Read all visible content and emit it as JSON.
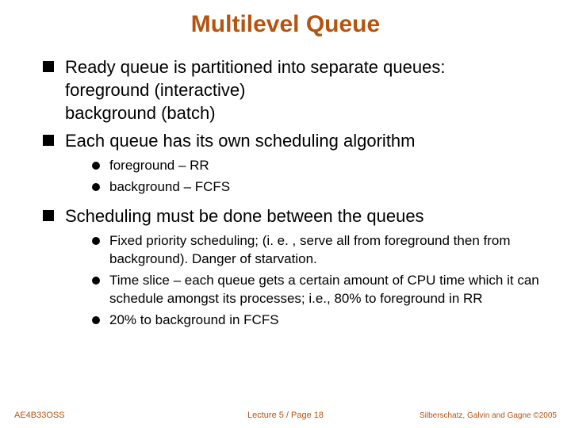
{
  "title": "Multilevel Queue",
  "bullets": {
    "b1": {
      "line1": "Ready queue is partitioned into separate queues:",
      "line2": "foreground (interactive)",
      "line3": "background (batch)"
    },
    "b2": {
      "text": "Each queue has its own scheduling algorithm",
      "sub": {
        "s1": "foreground – RR",
        "s2": "background – FCFS"
      }
    },
    "b3": {
      "text": "Scheduling must be done between the queues",
      "sub": {
        "s1": "Fixed priority scheduling; (i. e. , serve all from foreground then from background).  Danger of starvation.",
        "s2": "Time slice – each queue gets a certain amount of CPU time which it can schedule amongst its processes; i.e., 80% to foreground in RR",
        "s3": "20% to background in FCFS"
      }
    }
  },
  "footer": {
    "left": "AE4B33OSS",
    "center": "Lecture 5 / Page 18",
    "right": "Silberschatz, Galvin and Gagne ©2005"
  }
}
